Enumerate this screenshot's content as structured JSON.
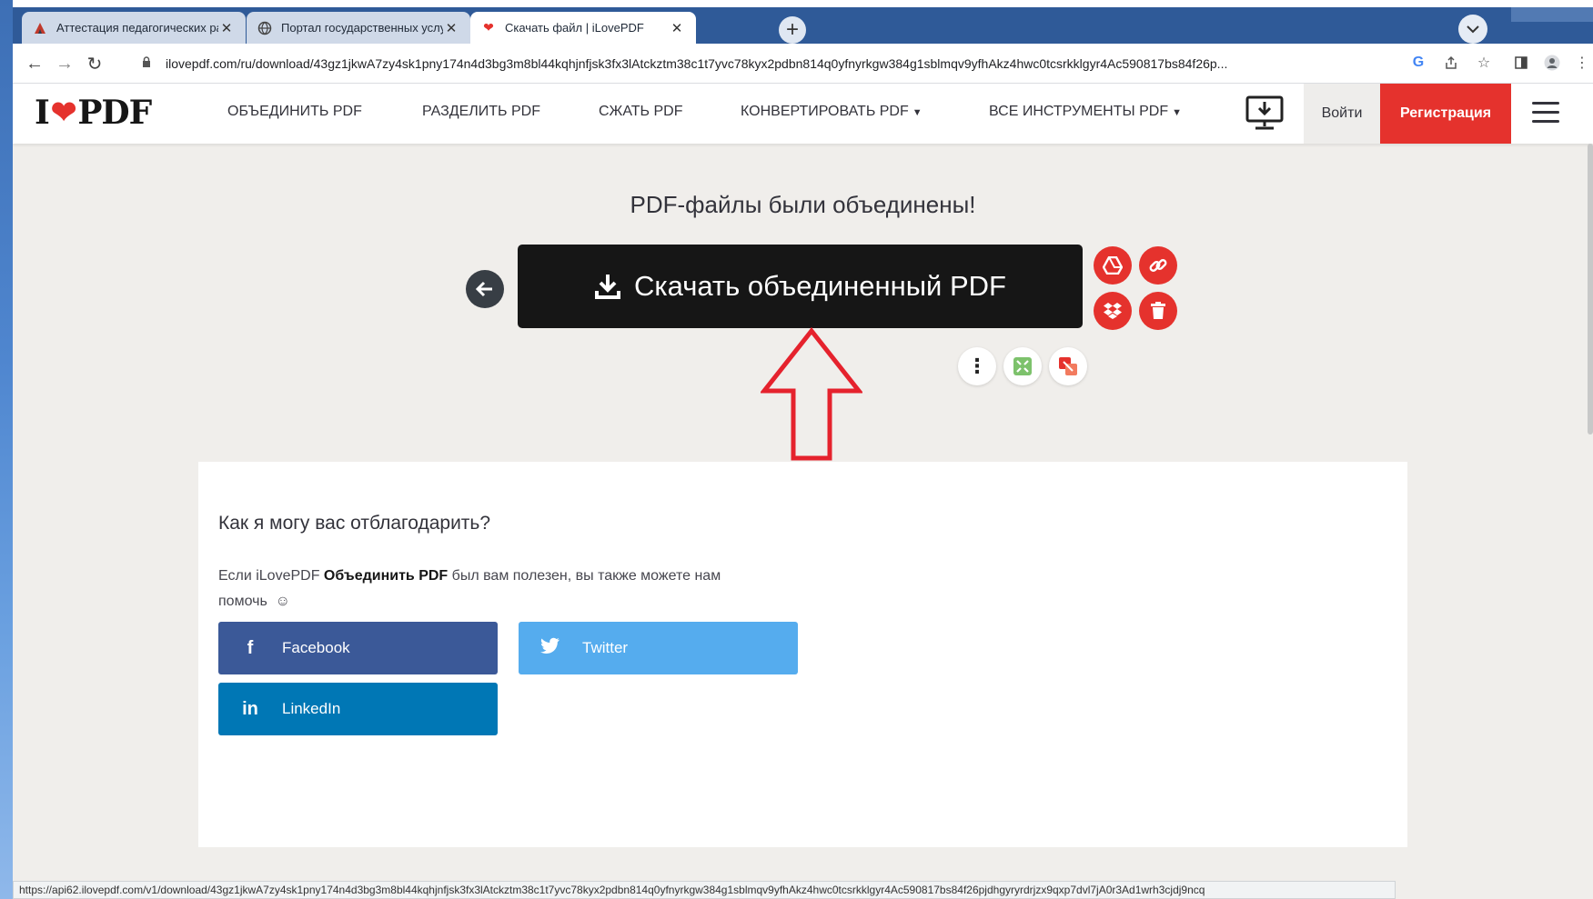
{
  "browser": {
    "tabs": [
      {
        "title": "Аттестация педагогических раб",
        "icon": "attestation-favicon"
      },
      {
        "title": "Портал государственных услуг",
        "icon": "globe-icon"
      },
      {
        "title": "Скачать файл | iLovePDF",
        "icon": "ilovepdf-heart-favicon"
      }
    ],
    "active_tab": 2,
    "url": "ilovepdf.com/ru/download/43gz1jkwA7zy4sk1pny174n4d3bg3m8bl44kqhjnfjsk3fx3lAtckztm38c1t7yvc78kyx2pdbn814q0yfnyrkgw384g1sblmqv9yfhAkz4hwc0tcsrkklgyr4Ac590817bs84f26p...",
    "status_url": "https://api62.ilovepdf.com/v1/download/43gz1jkwA7zy4sk1pny174n4d3bg3m8bl44kqhjnfjsk3fx3lAtckztm38c1t7yvc78kyx2pdbn814q0yfnyrkgw384g1sblmqv9yfhAkz4hwc0tcsrkklgyr4Ac590817bs84f26pjdhgyryrdrjzx9qxp7dvl7jA0r3Ad1wrh3cjdj9ncq"
  },
  "header": {
    "logo": {
      "left": "I",
      "right": "PDF"
    },
    "nav": [
      {
        "label": "ОБЪЕДИНИТЬ PDF"
      },
      {
        "label": "РАЗДЕЛИТЬ PDF"
      },
      {
        "label": "СЖАТЬ PDF"
      },
      {
        "label": "КОНВЕРТИРОВАТЬ PDF"
      },
      {
        "label": "ВСЕ ИНСТРУМЕНТЫ PDF"
      }
    ],
    "login": "Войти",
    "signup": "Регистрация"
  },
  "main": {
    "title": "PDF-файлы были объединены!",
    "download_label": "Скачать объединенный PDF"
  },
  "thanks": {
    "heading": "Как я могу вас отблагодарить?",
    "text_before": "Если iLovePDF ",
    "text_bold": "Объединить PDF",
    "text_after": " был вам полезен, вы также можете нам помочь",
    "smiley": "☺",
    "facebook": "Facebook",
    "twitter": "Twitter",
    "linkedin": "LinkedIn"
  },
  "colors": {
    "brand_red": "#e5322d",
    "dark": "#161616",
    "facebook": "#3b5998",
    "twitter": "#55acee",
    "linkedin": "#0077b5",
    "tabbar": "#2f5a98"
  }
}
